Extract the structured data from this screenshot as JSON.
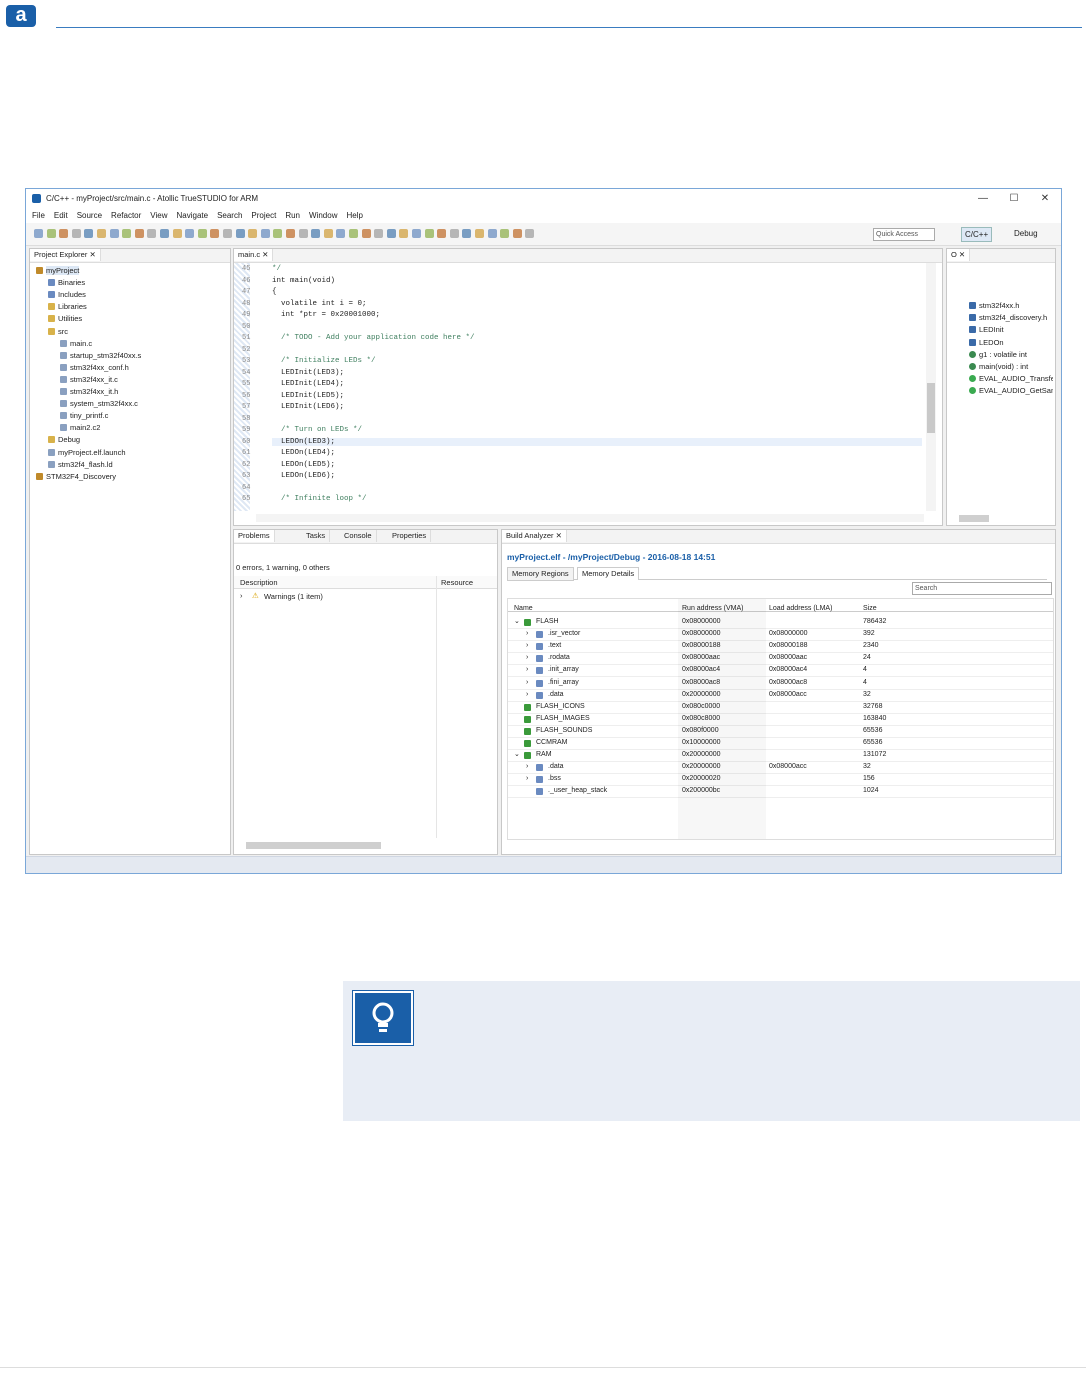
{
  "page": {
    "logo_letter": "a"
  },
  "window": {
    "title": "C/C++ - myProject/src/main.c - Atollic TrueSTUDIO for ARM",
    "minimize": "—",
    "maximize": "☐",
    "close": "✕",
    "menu": [
      "File",
      "Edit",
      "Source",
      "Refactor",
      "View",
      "Navigate",
      "Search",
      "Project",
      "Run",
      "Window",
      "Help"
    ],
    "quick_access": "Quick Access",
    "perspectives": [
      "C/C++",
      "Debug"
    ]
  },
  "project_explorer": {
    "tab": "Project Explorer",
    "items": [
      {
        "label": "myProject",
        "depth": 0,
        "type": "project"
      },
      {
        "label": "Binaries",
        "depth": 1,
        "type": "bin"
      },
      {
        "label": "Includes",
        "depth": 1,
        "type": "inc"
      },
      {
        "label": "Libraries",
        "depth": 1,
        "type": "folder"
      },
      {
        "label": "Utilities",
        "depth": 1,
        "type": "folder"
      },
      {
        "label": "src",
        "depth": 1,
        "type": "folder"
      },
      {
        "label": "main.c",
        "depth": 2,
        "type": "file"
      },
      {
        "label": "startup_stm32f40xx.s",
        "depth": 2,
        "type": "file"
      },
      {
        "label": "stm32f4xx_conf.h",
        "depth": 2,
        "type": "file"
      },
      {
        "label": "stm32f4xx_it.c",
        "depth": 2,
        "type": "file"
      },
      {
        "label": "stm32f4xx_it.h",
        "depth": 2,
        "type": "file"
      },
      {
        "label": "system_stm32f4xx.c",
        "depth": 2,
        "type": "file"
      },
      {
        "label": "tiny_printf.c",
        "depth": 2,
        "type": "file"
      },
      {
        "label": "main2.c2",
        "depth": 2,
        "type": "file"
      },
      {
        "label": "Debug",
        "depth": 1,
        "type": "folder"
      },
      {
        "label": "myProject.elf.launch",
        "depth": 1,
        "type": "file"
      },
      {
        "label": "stm32f4_flash.ld",
        "depth": 1,
        "type": "file"
      },
      {
        "label": "STM32F4_Discovery",
        "depth": 0,
        "type": "project"
      }
    ]
  },
  "editor": {
    "tab": "main.c",
    "lines": [
      {
        "n": "45",
        "text": "*/"
      },
      {
        "n": "46",
        "text": "int main(void)"
      },
      {
        "n": "47",
        "text": "{"
      },
      {
        "n": "48",
        "text": "  volatile int i = 0;"
      },
      {
        "n": "49",
        "text": "  int *ptr = 0x20001000;"
      },
      {
        "n": "50",
        "text": ""
      },
      {
        "n": "51",
        "text": "  /* TODO - Add your application code here */"
      },
      {
        "n": "52",
        "text": ""
      },
      {
        "n": "53",
        "text": "  /* Initialize LEDs */"
      },
      {
        "n": "54",
        "text": "  LEDInit(LED3);"
      },
      {
        "n": "55",
        "text": "  LEDInit(LED4);"
      },
      {
        "n": "56",
        "text": "  LEDInit(LED5);"
      },
      {
        "n": "57",
        "text": "  LEDInit(LED6);"
      },
      {
        "n": "58",
        "text": ""
      },
      {
        "n": "59",
        "text": "  /* Turn on LEDs */"
      },
      {
        "n": "60",
        "text": "  LEDOn(LED3);"
      },
      {
        "n": "61",
        "text": "  LEDOn(LED4);"
      },
      {
        "n": "62",
        "text": "  LEDOn(LED5);"
      },
      {
        "n": "63",
        "text": "  LEDOn(LED6);"
      },
      {
        "n": "64",
        "text": ""
      },
      {
        "n": "65",
        "text": "  /* Infinite loop */"
      }
    ]
  },
  "outline": {
    "items": [
      "stm32f4xx.h",
      "stm32f4_discovery.h",
      "LEDInit",
      "LEDOn",
      "g1 : volatile int",
      "main(void) : int",
      "EVAL_AUDIO_TransferComplete",
      "EVAL_AUDIO_GetSample"
    ]
  },
  "problems": {
    "tabs": [
      "Problems",
      "Tasks",
      "Console",
      "Properties"
    ],
    "summary": "0 errors, 1 warning, 0 others",
    "col_description": "Description",
    "col_resource": "Resource",
    "row": "Warnings (1 item)"
  },
  "build_analyzer": {
    "tab": "Build Analyzer",
    "path": "myProject.elf - /myProject/Debug - 2016-08-18 14:51",
    "subtabs": [
      "Memory Regions",
      "Memory Details"
    ],
    "search_placeholder": "Search",
    "columns": [
      "Name",
      "Run address (VMA)",
      "Load address (LMA)",
      "Size"
    ],
    "rows": [
      {
        "name": "FLASH",
        "vma": "0x08000000",
        "lma": "",
        "size": "786432",
        "indent": 0,
        "expand": "v",
        "kind": "region"
      },
      {
        "name": ".isr_vector",
        "vma": "0x08000000",
        "lma": "0x08000000",
        "size": "392",
        "indent": 1,
        "expand": ">",
        "kind": "section"
      },
      {
        "name": ".text",
        "vma": "0x08000188",
        "lma": "0x08000188",
        "size": "2340",
        "indent": 1,
        "expand": ">",
        "kind": "section"
      },
      {
        "name": ".rodata",
        "vma": "0x08000aac",
        "lma": "0x08000aac",
        "size": "24",
        "indent": 1,
        "expand": ">",
        "kind": "section"
      },
      {
        "name": ".init_array",
        "vma": "0x08000ac4",
        "lma": "0x08000ac4",
        "size": "4",
        "indent": 1,
        "expand": ">",
        "kind": "section"
      },
      {
        "name": ".fini_array",
        "vma": "0x08000ac8",
        "lma": "0x08000ac8",
        "size": "4",
        "indent": 1,
        "expand": ">",
        "kind": "section"
      },
      {
        "name": ".data",
        "vma": "0x20000000",
        "lma": "0x08000acc",
        "size": "32",
        "indent": 1,
        "expand": ">",
        "kind": "section"
      },
      {
        "name": "FLASH_ICONS",
        "vma": "0x080c0000",
        "lma": "",
        "size": "32768",
        "indent": 0,
        "expand": "",
        "kind": "region"
      },
      {
        "name": "FLASH_IMAGES",
        "vma": "0x080c8000",
        "lma": "",
        "size": "163840",
        "indent": 0,
        "expand": "",
        "kind": "region"
      },
      {
        "name": "FLASH_SOUNDS",
        "vma": "0x080f0000",
        "lma": "",
        "size": "65536",
        "indent": 0,
        "expand": "",
        "kind": "region"
      },
      {
        "name": "CCMRAM",
        "vma": "0x10000000",
        "lma": "",
        "size": "65536",
        "indent": 0,
        "expand": "",
        "kind": "region"
      },
      {
        "name": "RAM",
        "vma": "0x20000000",
        "lma": "",
        "size": "131072",
        "indent": 0,
        "expand": "v",
        "kind": "region"
      },
      {
        "name": ".data",
        "vma": "0x20000000",
        "lma": "0x08000acc",
        "size": "32",
        "indent": 1,
        "expand": ">",
        "kind": "section"
      },
      {
        "name": ".bss",
        "vma": "0x20000020",
        "lma": "",
        "size": "156",
        "indent": 1,
        "expand": ">",
        "kind": "section"
      },
      {
        "name": "._user_heap_stack",
        "vma": "0x200000bc",
        "lma": "",
        "size": "1024",
        "indent": 1,
        "expand": "",
        "kind": "section"
      }
    ]
  },
  "colors": {
    "accent": "#1a5fa8",
    "window_border": "#7aa7d8",
    "tip_bg": "#e8edf5"
  }
}
